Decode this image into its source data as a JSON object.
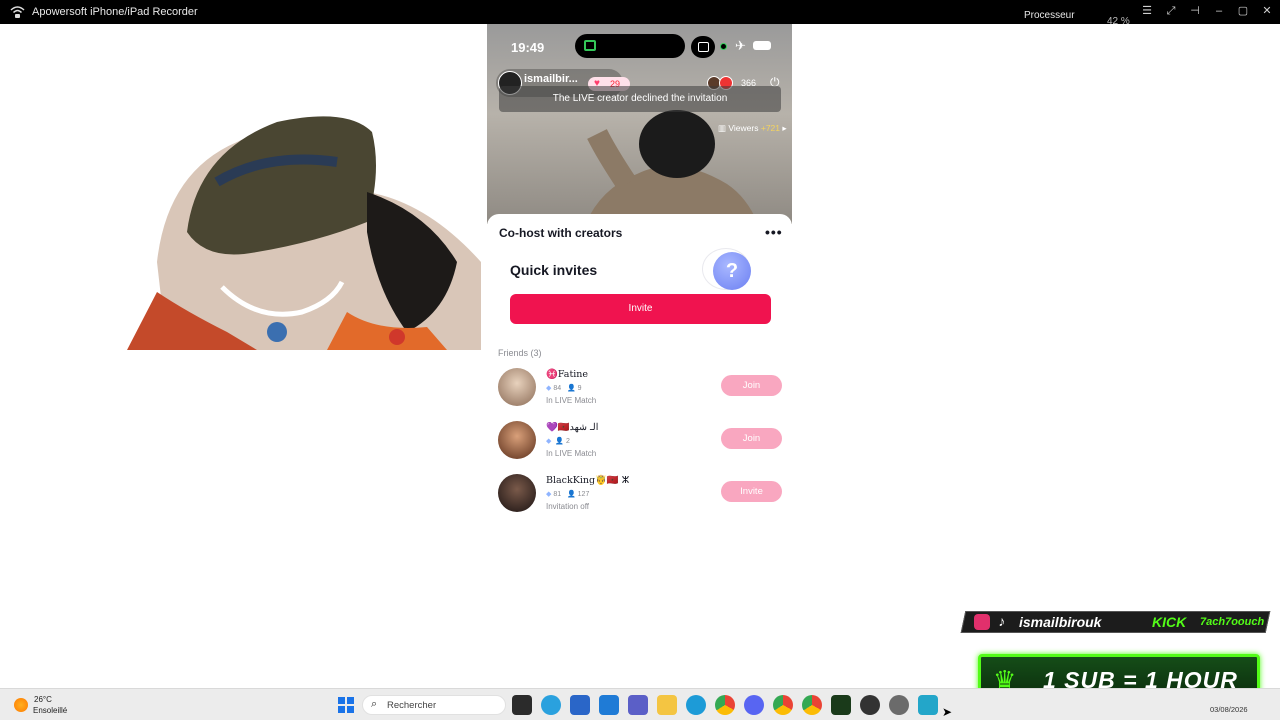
{
  "titlebar": {
    "app_title": "Apowersoft iPhone/iPad Recorder",
    "cpu_label": "Processeur",
    "cpu_value": "42 %"
  },
  "phone": {
    "status_time": "19:49",
    "creator_name": "ismailbir...",
    "likes": "29",
    "viewer_count": "366",
    "toast": "The LIVE creator declined the invitation",
    "viewers_label": "Viewers",
    "viewers_delta": "+721"
  },
  "sheet": {
    "title": "Co-host with creators",
    "more": "•••",
    "quick_invites": "Quick invites",
    "quick_icon": "?",
    "invite_button": "Invite",
    "friends_label": "Friends (3)",
    "friends": [
      {
        "name": "♓Fatine",
        "gems": "84",
        "people": "9",
        "status": "In LIVE Match",
        "action": "Join",
        "avatar_color": "#c9a98a"
      },
      {
        "name": "💜🇲🇦الـ شهد",
        "gems": "",
        "people": "2",
        "status": "In LIVE Match",
        "action": "Join",
        "avatar_color": "#8a5a3a"
      },
      {
        "name": "BlackKing🤴🇲🇦 ⵣ",
        "gems": "81",
        "people": "127",
        "status": "Invitation off",
        "action": "Invite",
        "avatar_color": "#3a2a2a"
      }
    ]
  },
  "overlay": {
    "social_handle": "ismailbirouk",
    "kick_label": "KICK",
    "kick_handle": "7ach7oouch",
    "sub_text": "1 SUB = 1 HOUR"
  },
  "taskbar": {
    "weather_temp": "26°C",
    "weather_cond": "Ensoleillé",
    "search_placeholder": "Rechercher",
    "date": "03/08/2026"
  },
  "colors": {
    "invite_red": "#f0134f",
    "join_pink": "#f9a7c0",
    "kick_green": "#53fc18"
  }
}
